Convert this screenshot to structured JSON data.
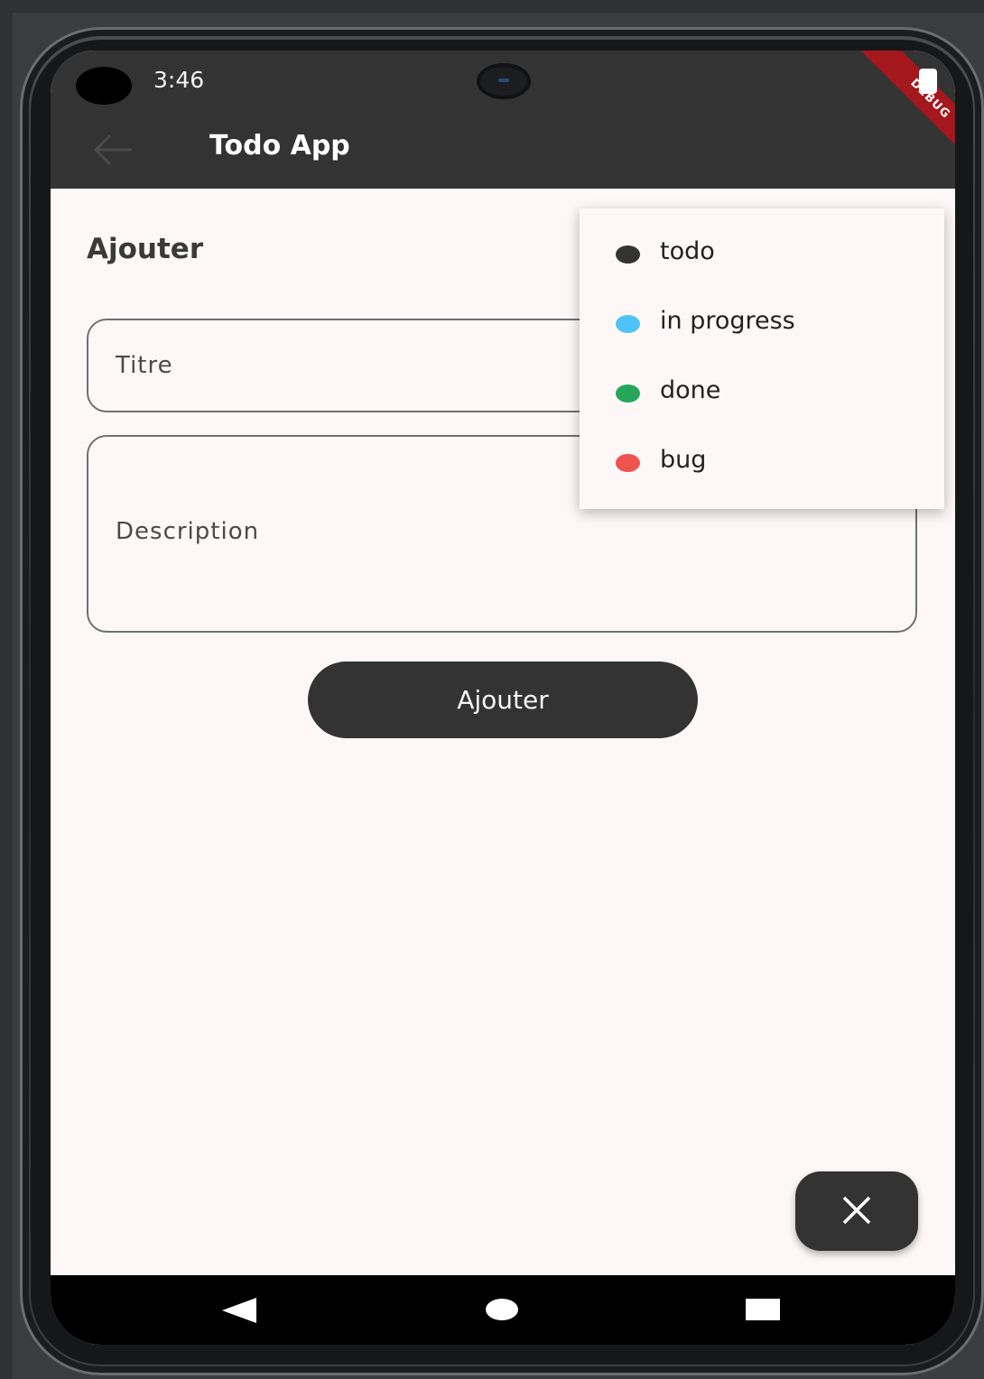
{
  "status_bar": {
    "time": "3:46",
    "debug_banner": "DEBUG"
  },
  "app_bar": {
    "title": "Todo App",
    "back_icon": "arrow-left-icon"
  },
  "form": {
    "section_title": "Ajouter",
    "title_field": {
      "placeholder": "Titre",
      "value": ""
    },
    "description_field": {
      "placeholder": "Description",
      "value": ""
    },
    "submit_label": "Ajouter"
  },
  "status_menu": {
    "items": [
      {
        "label": "todo",
        "color": "#333333"
      },
      {
        "label": "in progress",
        "color": "#4fc3f7"
      },
      {
        "label": "done",
        "color": "#26a65b"
      },
      {
        "label": "bug",
        "color": "#ef5350"
      }
    ]
  },
  "fab": {
    "icon": "close-icon"
  },
  "nav_bar": {
    "back_icon": "nav-back-icon",
    "home_icon": "nav-home-icon",
    "recents_icon": "nav-recents-icon"
  },
  "colors": {
    "app_bar": "#333333",
    "background": "#fdf8f7",
    "primary": "#333333"
  }
}
